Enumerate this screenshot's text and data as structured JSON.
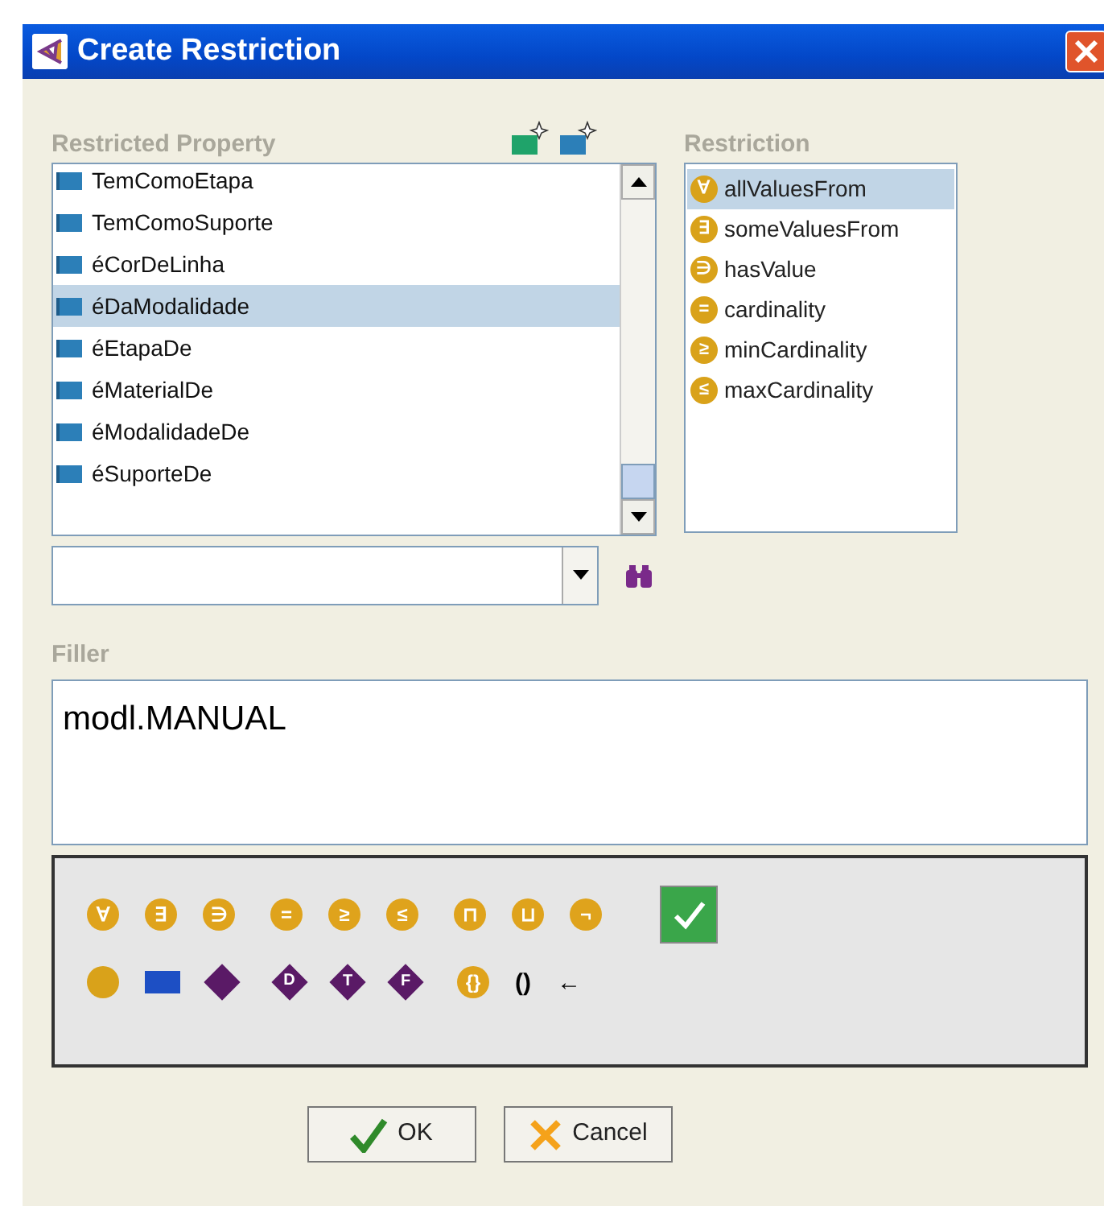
{
  "window": {
    "title": "Create Restriction"
  },
  "restricted_property": {
    "label": "Restricted Property",
    "items": [
      {
        "name": "TemComoEtapa",
        "selected": false
      },
      {
        "name": "TemComoSuporte",
        "selected": false
      },
      {
        "name": "éCorDeLinha",
        "selected": false
      },
      {
        "name": "éDaModalidade",
        "selected": true
      },
      {
        "name": "éEtapaDe",
        "selected": false
      },
      {
        "name": "éMaterialDe",
        "selected": false
      },
      {
        "name": "éModalidadeDe",
        "selected": false
      },
      {
        "name": "éSuporteDe",
        "selected": false
      }
    ]
  },
  "restriction": {
    "label": "Restriction",
    "items": [
      {
        "symbol": "∀",
        "name": "allValuesFrom",
        "selected": true
      },
      {
        "symbol": "∃",
        "name": "someValuesFrom",
        "selected": false
      },
      {
        "symbol": "∋",
        "name": "hasValue",
        "selected": false
      },
      {
        "symbol": "=",
        "name": "cardinality",
        "selected": false
      },
      {
        "symbol": "≥",
        "name": "minCardinality",
        "selected": false
      },
      {
        "symbol": "≤",
        "name": "maxCardinality",
        "selected": false
      }
    ]
  },
  "filler": {
    "label": "Filler",
    "value": "modl.MANUAL"
  },
  "symbol_rows": [
    [
      [
        {
          "kind": "circle",
          "symbol": "∀"
        },
        {
          "kind": "circle",
          "symbol": "∃"
        },
        {
          "kind": "circle",
          "symbol": "∋"
        }
      ],
      [
        {
          "kind": "circle",
          "symbol": "="
        },
        {
          "kind": "circle",
          "symbol": "≥"
        },
        {
          "kind": "circle",
          "symbol": "≤"
        }
      ],
      [
        {
          "kind": "circle",
          "symbol": "⊓"
        },
        {
          "kind": "circle",
          "symbol": "⊔"
        },
        {
          "kind": "circle",
          "symbol": "¬"
        }
      ],
      [
        {
          "kind": "check"
        }
      ]
    ],
    [
      [
        {
          "kind": "dot"
        },
        {
          "kind": "rect"
        },
        {
          "kind": "diamond"
        }
      ],
      [
        {
          "kind": "diamond",
          "symbol": "D"
        },
        {
          "kind": "diamond",
          "symbol": "T"
        },
        {
          "kind": "diamond",
          "symbol": "F"
        }
      ],
      [
        {
          "kind": "circle",
          "symbol": "{}"
        },
        {
          "kind": "plain",
          "symbol": "()"
        },
        {
          "kind": "plain",
          "symbol": "←"
        }
      ]
    ]
  ],
  "buttons": [
    {
      "kind": "ok",
      "label": "OK"
    },
    {
      "kind": "cancel",
      "label": "Cancel"
    }
  ]
}
